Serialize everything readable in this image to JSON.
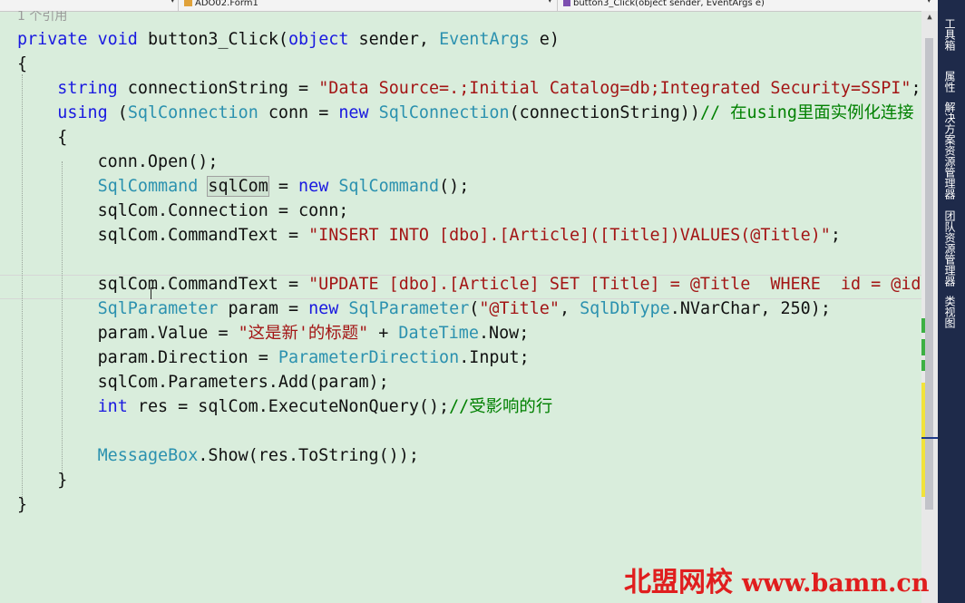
{
  "navigation_bar": {
    "project_dropdown": "",
    "class_dropdown": "ADO02.Form1",
    "member_dropdown": "button3_Click(object sender, EventArgs e)"
  },
  "editor": {
    "reference_count": "1 个引用",
    "lines": [
      [
        [
          "kw",
          "private"
        ],
        [
          "pl",
          " "
        ],
        [
          "kw",
          "void"
        ],
        [
          "pl",
          " button3_Click("
        ],
        [
          "kw",
          "object"
        ],
        [
          "pl",
          " sender, "
        ],
        [
          "ty",
          "EventArgs"
        ],
        [
          "pl",
          " e)"
        ]
      ],
      [
        [
          "pl",
          "{"
        ]
      ],
      [
        [
          "pl",
          "    "
        ],
        [
          "kw",
          "string"
        ],
        [
          "pl",
          " connectionString = "
        ],
        [
          "st",
          "\"Data Source=.;Initial Catalog=db;Integrated Security=SSPI\""
        ],
        [
          "pl",
          ";"
        ]
      ],
      [
        [
          "pl",
          "    "
        ],
        [
          "kw",
          "using"
        ],
        [
          "pl",
          " ("
        ],
        [
          "ty",
          "SqlConnection"
        ],
        [
          "pl",
          " conn = "
        ],
        [
          "kw",
          "new"
        ],
        [
          "pl",
          " "
        ],
        [
          "ty",
          "SqlConnection"
        ],
        [
          "pl",
          "(connectionString))"
        ],
        [
          "cm",
          "// 在using里面实例化连接"
        ]
      ],
      [
        [
          "pl",
          "    {"
        ]
      ],
      [
        [
          "pl",
          "        conn.Open();"
        ]
      ],
      [
        [
          "pl",
          "        "
        ],
        [
          "ty",
          "SqlCommand"
        ],
        [
          "pl",
          " "
        ],
        [
          "hl",
          "sqlCom"
        ],
        [
          "pl",
          " = "
        ],
        [
          "kw",
          "new"
        ],
        [
          "pl",
          " "
        ],
        [
          "ty",
          "SqlCommand"
        ],
        [
          "pl",
          "();"
        ]
      ],
      [
        [
          "pl",
          "        sqlCom.Connection = conn;"
        ]
      ],
      [
        [
          "pl",
          "        sqlCom.CommandText = "
        ],
        [
          "st",
          "\"INSERT INTO [dbo].[Article]([Title])VALUES(@Title)\""
        ],
        [
          "pl",
          ";"
        ]
      ],
      [],
      [
        [
          "pl",
          "        sqlCom.CommandText = "
        ],
        [
          "st",
          "\"UPDATE [dbo].[Article] SET [Title] = @Title  WHERE  id = @id\""
        ],
        [
          "pl",
          ";"
        ]
      ],
      [
        [
          "pl",
          "        "
        ],
        [
          "ty",
          "SqlParameter"
        ],
        [
          "pl",
          " param = "
        ],
        [
          "kw",
          "new"
        ],
        [
          "pl",
          " "
        ],
        [
          "ty",
          "SqlParameter"
        ],
        [
          "pl",
          "("
        ],
        [
          "st",
          "\"@Title\""
        ],
        [
          "pl",
          ", "
        ],
        [
          "ty",
          "SqlDbType"
        ],
        [
          "pl",
          ".NVarChar, 250);"
        ]
      ],
      [
        [
          "pl",
          "        param.Value = "
        ],
        [
          "st",
          "\"这是新'的标题\""
        ],
        [
          "pl",
          " + "
        ],
        [
          "ty",
          "DateTime"
        ],
        [
          "pl",
          ".Now;"
        ]
      ],
      [
        [
          "pl",
          "        param.Direction = "
        ],
        [
          "ty",
          "ParameterDirection"
        ],
        [
          "pl",
          ".Input;"
        ]
      ],
      [
        [
          "pl",
          "        sqlCom.Parameters.Add(param);"
        ]
      ],
      [
        [
          "pl",
          "        "
        ],
        [
          "kw",
          "int"
        ],
        [
          "pl",
          " res = sqlCom.ExecuteNonQuery();"
        ],
        [
          "cm",
          "//受影响的行"
        ]
      ],
      [],
      [
        [
          "pl",
          "        "
        ],
        [
          "ty",
          "MessageBox"
        ],
        [
          "pl",
          ".Show(res.ToString());"
        ]
      ],
      [
        [
          "pl",
          "    }"
        ]
      ],
      [
        [
          "pl",
          "}"
        ]
      ]
    ]
  },
  "right_dock": {
    "tabs": [
      "工具箱",
      "属性",
      "解决方案资源管理器",
      "团队资源管理器",
      "类视图"
    ]
  },
  "watermark": {
    "brand": "北盟网校",
    "url": "www.bamn.cn"
  },
  "colors": {
    "keyword": "#1919e0",
    "type": "#2b91af",
    "string": "#a31515",
    "comment": "#008000",
    "editor_background": "#d9eddc"
  }
}
